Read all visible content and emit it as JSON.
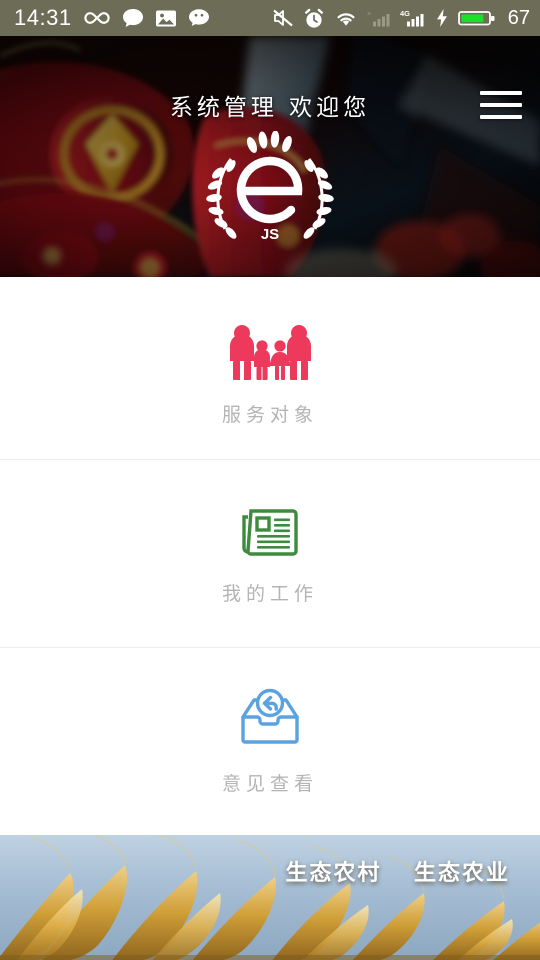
{
  "statusbar": {
    "time": "14:31",
    "battery_percent": "67",
    "left_icons": [
      {
        "name": "infinity-icon",
        "glyph": "∞"
      },
      {
        "name": "message-bubble-icon",
        "glyph": "●"
      },
      {
        "name": "photo-gallery-icon",
        "glyph": "▣"
      },
      {
        "name": "wechat-icon",
        "glyph": "●"
      }
    ],
    "right_icons": [
      {
        "name": "mute-icon"
      },
      {
        "name": "alarm-clock-icon"
      },
      {
        "name": "wifi-icon"
      },
      {
        "name": "signal-sim1-icon"
      },
      {
        "name": "signal-4g-icon",
        "label": "4G"
      },
      {
        "name": "charging-bolt-icon"
      },
      {
        "name": "battery-icon"
      }
    ]
  },
  "header": {
    "title": "系统管理  欢迎您",
    "menu_button_label": "menu",
    "logo": {
      "letter": "e",
      "sub_text": "JS"
    }
  },
  "menu": {
    "items": [
      {
        "id": "service-objects",
        "label": "服务对象",
        "icon": "family-group-icon",
        "color": "#ED3A5C"
      },
      {
        "id": "my-work",
        "label": "我的工作",
        "icon": "newspaper-document-icon",
        "color": "#3D8B3D"
      },
      {
        "id": "view-feedback",
        "label": "意见查看",
        "icon": "inbox-reply-icon",
        "color": "#5BA2E0"
      }
    ]
  },
  "banner": {
    "text": "生态农村    生态农业"
  },
  "colors": {
    "statusbar_bg": "#6d6d57",
    "label_gray": "#b4b4b4",
    "accent_pink": "#ED3A5C",
    "accent_green": "#3D8B3D",
    "accent_blue": "#5BA2E0"
  }
}
